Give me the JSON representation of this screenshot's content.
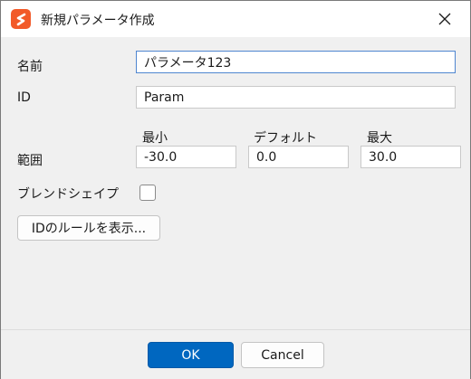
{
  "window": {
    "title": "新規パラメータ作成",
    "accent_color": "#0067c0",
    "icon_color": "#f25a29"
  },
  "form": {
    "name_label": "名前",
    "name_value": "パラメータ123",
    "id_label": "ID",
    "id_value": "Param",
    "range_label": "範囲",
    "min_label": "最小",
    "min_value": "-30.0",
    "default_label": "デフォルト",
    "default_value": "0.0",
    "max_label": "最大",
    "max_value": "30.0",
    "blendshape_label": "ブレンドシェイプ",
    "blendshape_checked": false,
    "id_rules_button": "IDのルールを表示..."
  },
  "footer": {
    "ok_label": "OK",
    "cancel_label": "Cancel"
  }
}
